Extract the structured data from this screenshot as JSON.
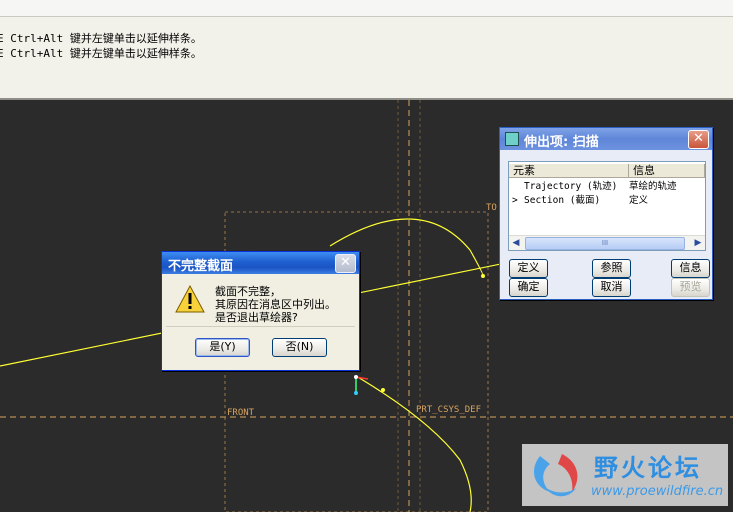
{
  "message_area": {
    "lines": [
      "E Ctrl+Alt 键并左键单击以延伸样条。",
      "E Ctrl+Alt 键并左键单击以延伸样条。"
    ]
  },
  "graphics": {
    "labels": [
      "TO",
      "FRONT",
      "PRT_CSYS_DEF"
    ],
    "colors": {
      "background": "#2b2b2b",
      "datum": "#d9a35f",
      "curve": "#ffff33"
    }
  },
  "sweep_dialog": {
    "title": "伸出项: 扫描",
    "columns": [
      "元素",
      "信息"
    ],
    "rows": [
      {
        "marker": "",
        "element": "Trajectory (轨迹)",
        "info": "草绘的轨迹"
      },
      {
        "marker": ">",
        "element": "Section (截面)",
        "info": "定义"
      }
    ],
    "scrollbar_grip": "III",
    "buttons": {
      "define": "定义",
      "reference": "参照",
      "info": "信息",
      "ok": "确定",
      "cancel": "取消",
      "preview": "预览"
    }
  },
  "warning_dialog": {
    "title": "不完整截面",
    "icon": "warning-icon",
    "lines": [
      "截面不完整，",
      "其原因在消息区中列出。",
      "是否退出草绘器?"
    ],
    "yes": "是(Y)",
    "no": "否(N)"
  },
  "watermark": {
    "title": "野火论坛",
    "url": "www.proewildfire.cn"
  }
}
